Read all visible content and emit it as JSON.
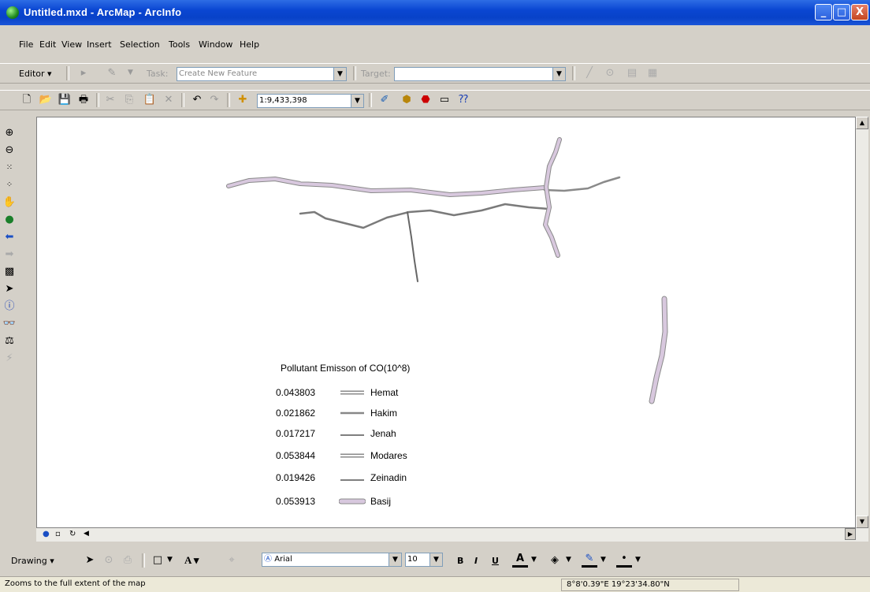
{
  "window": {
    "title": "Untitled.mxd - ArcMap - ArcInfo",
    "buttons": {
      "minimize": "_",
      "maximize": "□",
      "close": "X"
    }
  },
  "menu": [
    "File",
    "Edit",
    "View",
    "Insert",
    "Selection",
    "Tools",
    "Window",
    "Help"
  ],
  "editor_toolbar": {
    "editor_label": "Editor ▾",
    "task_label": "Task:",
    "task_value": "Create New Feature",
    "target_label": "Target:",
    "target_value": ""
  },
  "standard_toolbar": {
    "scale_value": "1:9,433,398"
  },
  "drawing_toolbar": {
    "drawing_label": "Drawing ▾",
    "font_value": "Arial",
    "size_value": "10",
    "bold": "B",
    "italic": "I",
    "underline": "U",
    "text_tool": "A ▾"
  },
  "legend": {
    "title": "Pollutant Emisson of CO(10^8)",
    "items": [
      {
        "value": "0.043803",
        "name": "Hemat",
        "color": "#9a9a9a",
        "style": "double"
      },
      {
        "value": "0.021862",
        "name": "Hakim",
        "color": "#888888",
        "style": "single"
      },
      {
        "value": "0.017217",
        "name": "Jenah",
        "color": "#555555",
        "style": "thin"
      },
      {
        "value": "0.053844",
        "name": "Modares",
        "color": "#9a9a9a",
        "style": "double"
      },
      {
        "value": "0.019426",
        "name": "Zeinadin",
        "color": "#555555",
        "style": "thin"
      },
      {
        "value": "0.053913",
        "name": "Basij",
        "color": "#d8c8de",
        "style": "fill"
      }
    ]
  },
  "status": {
    "message": "Zooms to the full extent of the map",
    "coordinates": "8°8'0.39\"E  19°23'34.80\"N"
  },
  "colors": {
    "title_bar": "#0a46d2",
    "road_fill": "#d8c8de",
    "road_outline": "#8a8a8a"
  }
}
